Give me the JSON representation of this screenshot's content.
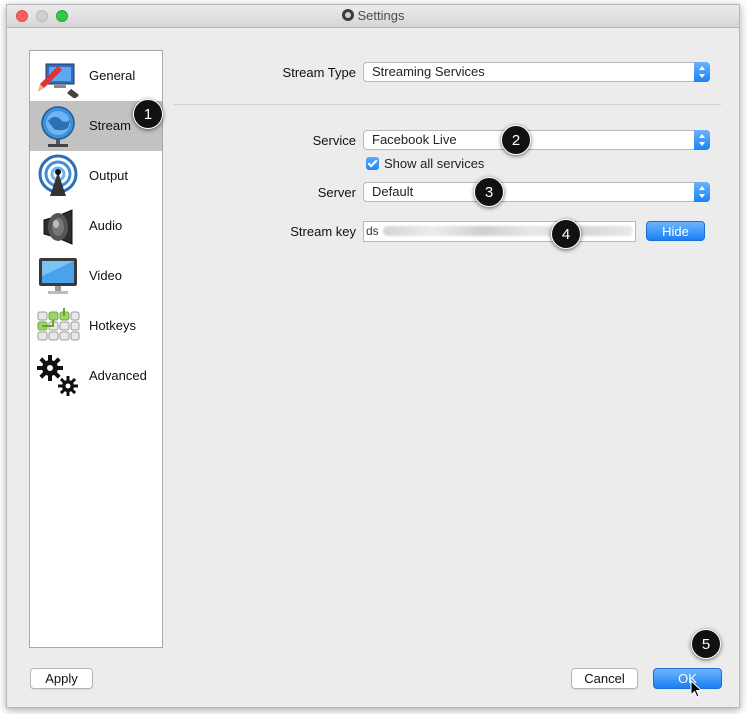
{
  "window": {
    "title": "Settings"
  },
  "sidebar": {
    "items": [
      {
        "label": "General",
        "icon": "general-icon"
      },
      {
        "label": "Stream",
        "icon": "stream-icon",
        "active": true
      },
      {
        "label": "Output",
        "icon": "output-icon"
      },
      {
        "label": "Audio",
        "icon": "audio-icon"
      },
      {
        "label": "Video",
        "icon": "video-icon"
      },
      {
        "label": "Hotkeys",
        "icon": "hotkeys-icon"
      },
      {
        "label": "Advanced",
        "icon": "advanced-icon"
      }
    ]
  },
  "stream": {
    "stream_type_label": "Stream Type",
    "stream_type_value": "Streaming Services",
    "service_label": "Service",
    "service_value": "Facebook Live",
    "show_all_label": "Show all services",
    "show_all_checked": true,
    "server_label": "Server",
    "server_value": "Default",
    "stream_key_label": "Stream key",
    "stream_key_prefix": "ds",
    "stream_key_suffix": "p",
    "hide_label": "Hide"
  },
  "footer": {
    "apply_label": "Apply",
    "cancel_label": "Cancel",
    "ok_label": "OK"
  },
  "annotations": [
    "1",
    "2",
    "3",
    "4",
    "5"
  ],
  "colors": {
    "accent": "#1f86f6",
    "active_row": "#c2c2c2",
    "badge": "#111111"
  }
}
